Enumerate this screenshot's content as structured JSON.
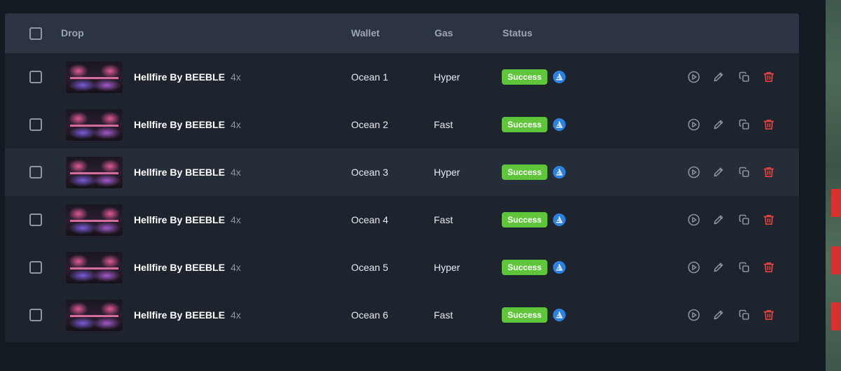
{
  "table": {
    "headers": {
      "drop": "Drop",
      "wallet": "Wallet",
      "gas": "Gas",
      "status": "Status"
    },
    "rows": [
      {
        "drop": "Hellfire By BEEBLE",
        "qty": "4x",
        "wallet": "Ocean 1",
        "gas": "Hyper",
        "status": "Success"
      },
      {
        "drop": "Hellfire By BEEBLE",
        "qty": "4x",
        "wallet": "Ocean 2",
        "gas": "Fast",
        "status": "Success"
      },
      {
        "drop": "Hellfire By BEEBLE",
        "qty": "4x",
        "wallet": "Ocean 3",
        "gas": "Hyper",
        "status": "Success"
      },
      {
        "drop": "Hellfire By BEEBLE",
        "qty": "4x",
        "wallet": "Ocean 4",
        "gas": "Fast",
        "status": "Success"
      },
      {
        "drop": "Hellfire By BEEBLE",
        "qty": "4x",
        "wallet": "Ocean 5",
        "gas": "Hyper",
        "status": "Success"
      },
      {
        "drop": "Hellfire By BEEBLE",
        "qty": "4x",
        "wallet": "Ocean 6",
        "gas": "Fast",
        "status": "Success"
      }
    ]
  },
  "icons": {
    "select_all": "checkbox",
    "row_select": "checkbox",
    "marketplace": "opensea-icon",
    "start": "play-icon",
    "edit": "pencil-icon",
    "duplicate": "copy-icon",
    "delete": "trash-icon"
  },
  "colors": {
    "success_badge": "#5fc63b",
    "delete_icon": "#e0443c",
    "brand_icon": "#2a81e2",
    "header_bg": "#2b3440",
    "row_bg": "#1d242e",
    "row_alt_bg": "#252d38"
  }
}
